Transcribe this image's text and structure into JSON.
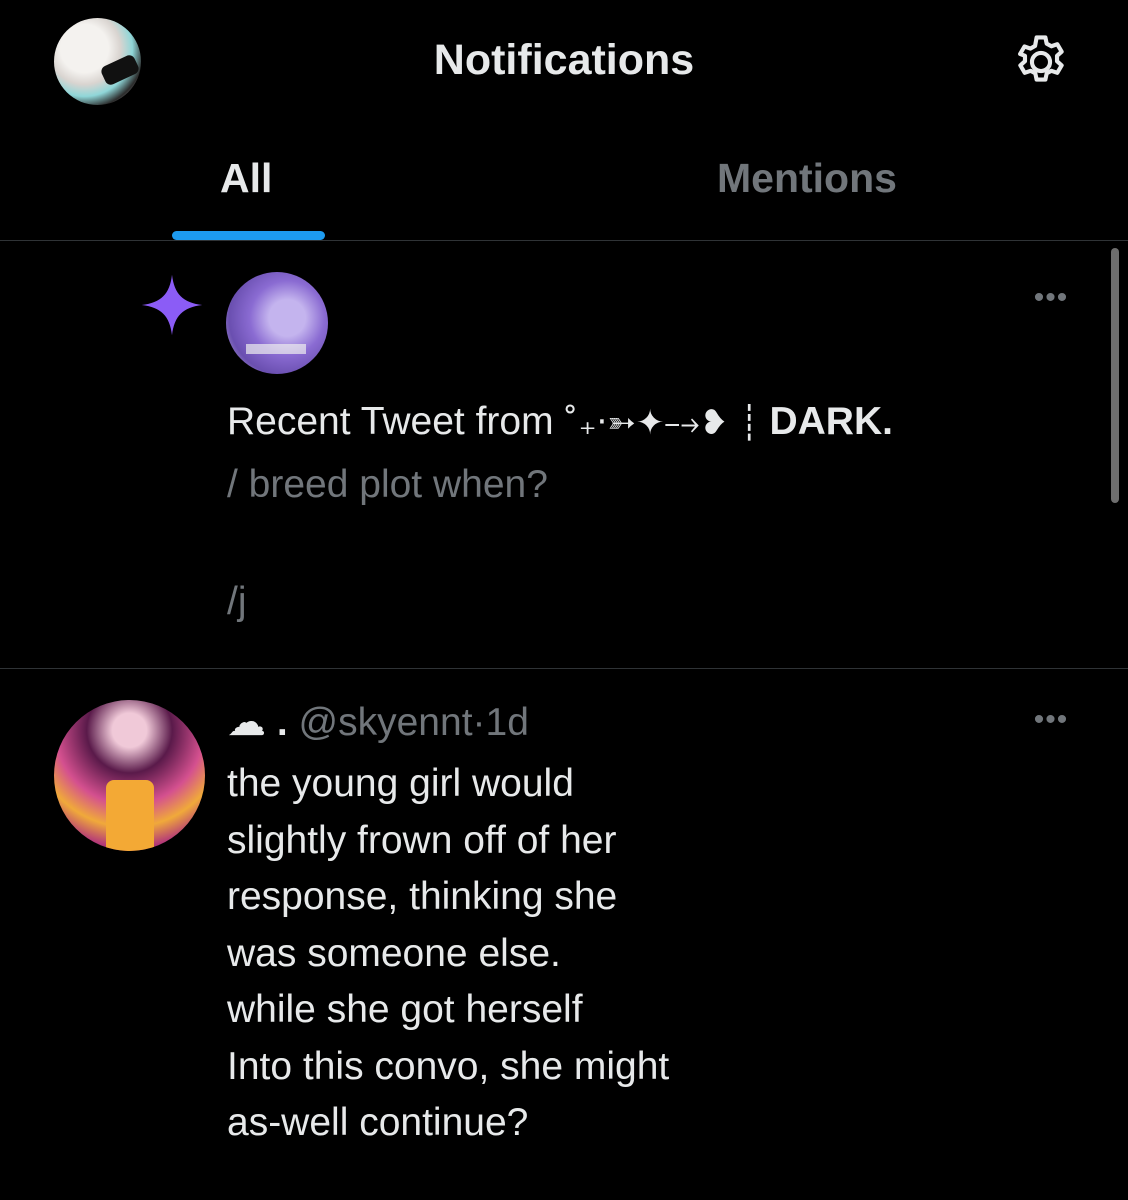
{
  "header": {
    "title": "Notifications",
    "avatar_icon": "profile-avatar",
    "settings_icon": "gear-icon"
  },
  "tabs": [
    {
      "label": "All",
      "active": true
    },
    {
      "label": "Mentions",
      "active": false
    }
  ],
  "colors": {
    "background": "#000000",
    "accent": "#1d9bf0",
    "text_primary": "#e7e9ea",
    "text_secondary": "#71767b",
    "sparkle": "#8b5cf6",
    "divider": "#2f3336"
  },
  "notifications": [
    {
      "type": "recent-tweet",
      "icon": "sparkle-icon",
      "prefix": "Recent Tweet from",
      "name_decoration": "˚₊‧➳✦⤍❥ ┊",
      "display_name": "DARK.",
      "preview_line1": "/ breed plot when?",
      "preview_line2": "/j",
      "more_label": "•••"
    },
    {
      "type": "mention",
      "display_name": "☁️.",
      "cloud": "☁",
      "dot": ".",
      "handle": "@skyennt",
      "separator": "·",
      "time": "1d",
      "more_label": "•••",
      "body_lines": [
        "the young girl would",
        "slightly frown off of her",
        "response, thinking she",
        "was someone else.",
        "while she got herself",
        "Into this convo, she might",
        "as-well continue?"
      ]
    }
  ]
}
